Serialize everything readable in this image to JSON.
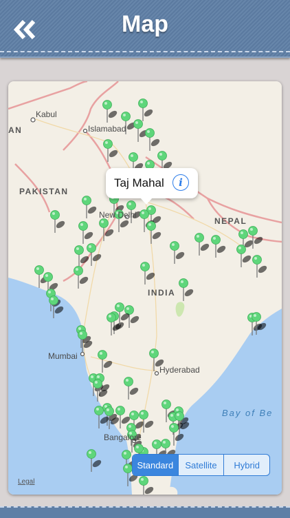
{
  "header": {
    "title": "Map",
    "back_icon": "double-chevron-left-icon"
  },
  "map": {
    "cities": [
      {
        "id": "kabul",
        "name": "Kabul"
      },
      {
        "id": "islamabad",
        "name": "Islamabad"
      },
      {
        "id": "new-delhi",
        "name": "New Delhi"
      },
      {
        "id": "mumbai",
        "name": "Mumbai"
      },
      {
        "id": "hyderabad",
        "name": "Hyderabad"
      },
      {
        "id": "bangalore",
        "name": "Bangalore"
      }
    ],
    "countries": [
      {
        "id": "pakistan",
        "name": "PAKISTAN"
      },
      {
        "id": "nepal",
        "name": "NEPAL"
      },
      {
        "id": "india",
        "name": "INDIA"
      },
      {
        "id": "an",
        "name": "AN"
      }
    ],
    "seas": [
      {
        "id": "bay-of-bengal",
        "name": "Bay of Be"
      }
    ],
    "colors": {
      "land": "#f3efe6",
      "water": "#a9cdf2",
      "border": "#e8a1a1",
      "pin": "#5fd67b"
    },
    "legal": "Legal"
  },
  "callout": {
    "title": "Taj Mahal",
    "info_icon": "info-circle-icon"
  },
  "map_type": {
    "options": [
      "Standard",
      "Satellite",
      "Hybrid"
    ],
    "selected": "Standard"
  }
}
